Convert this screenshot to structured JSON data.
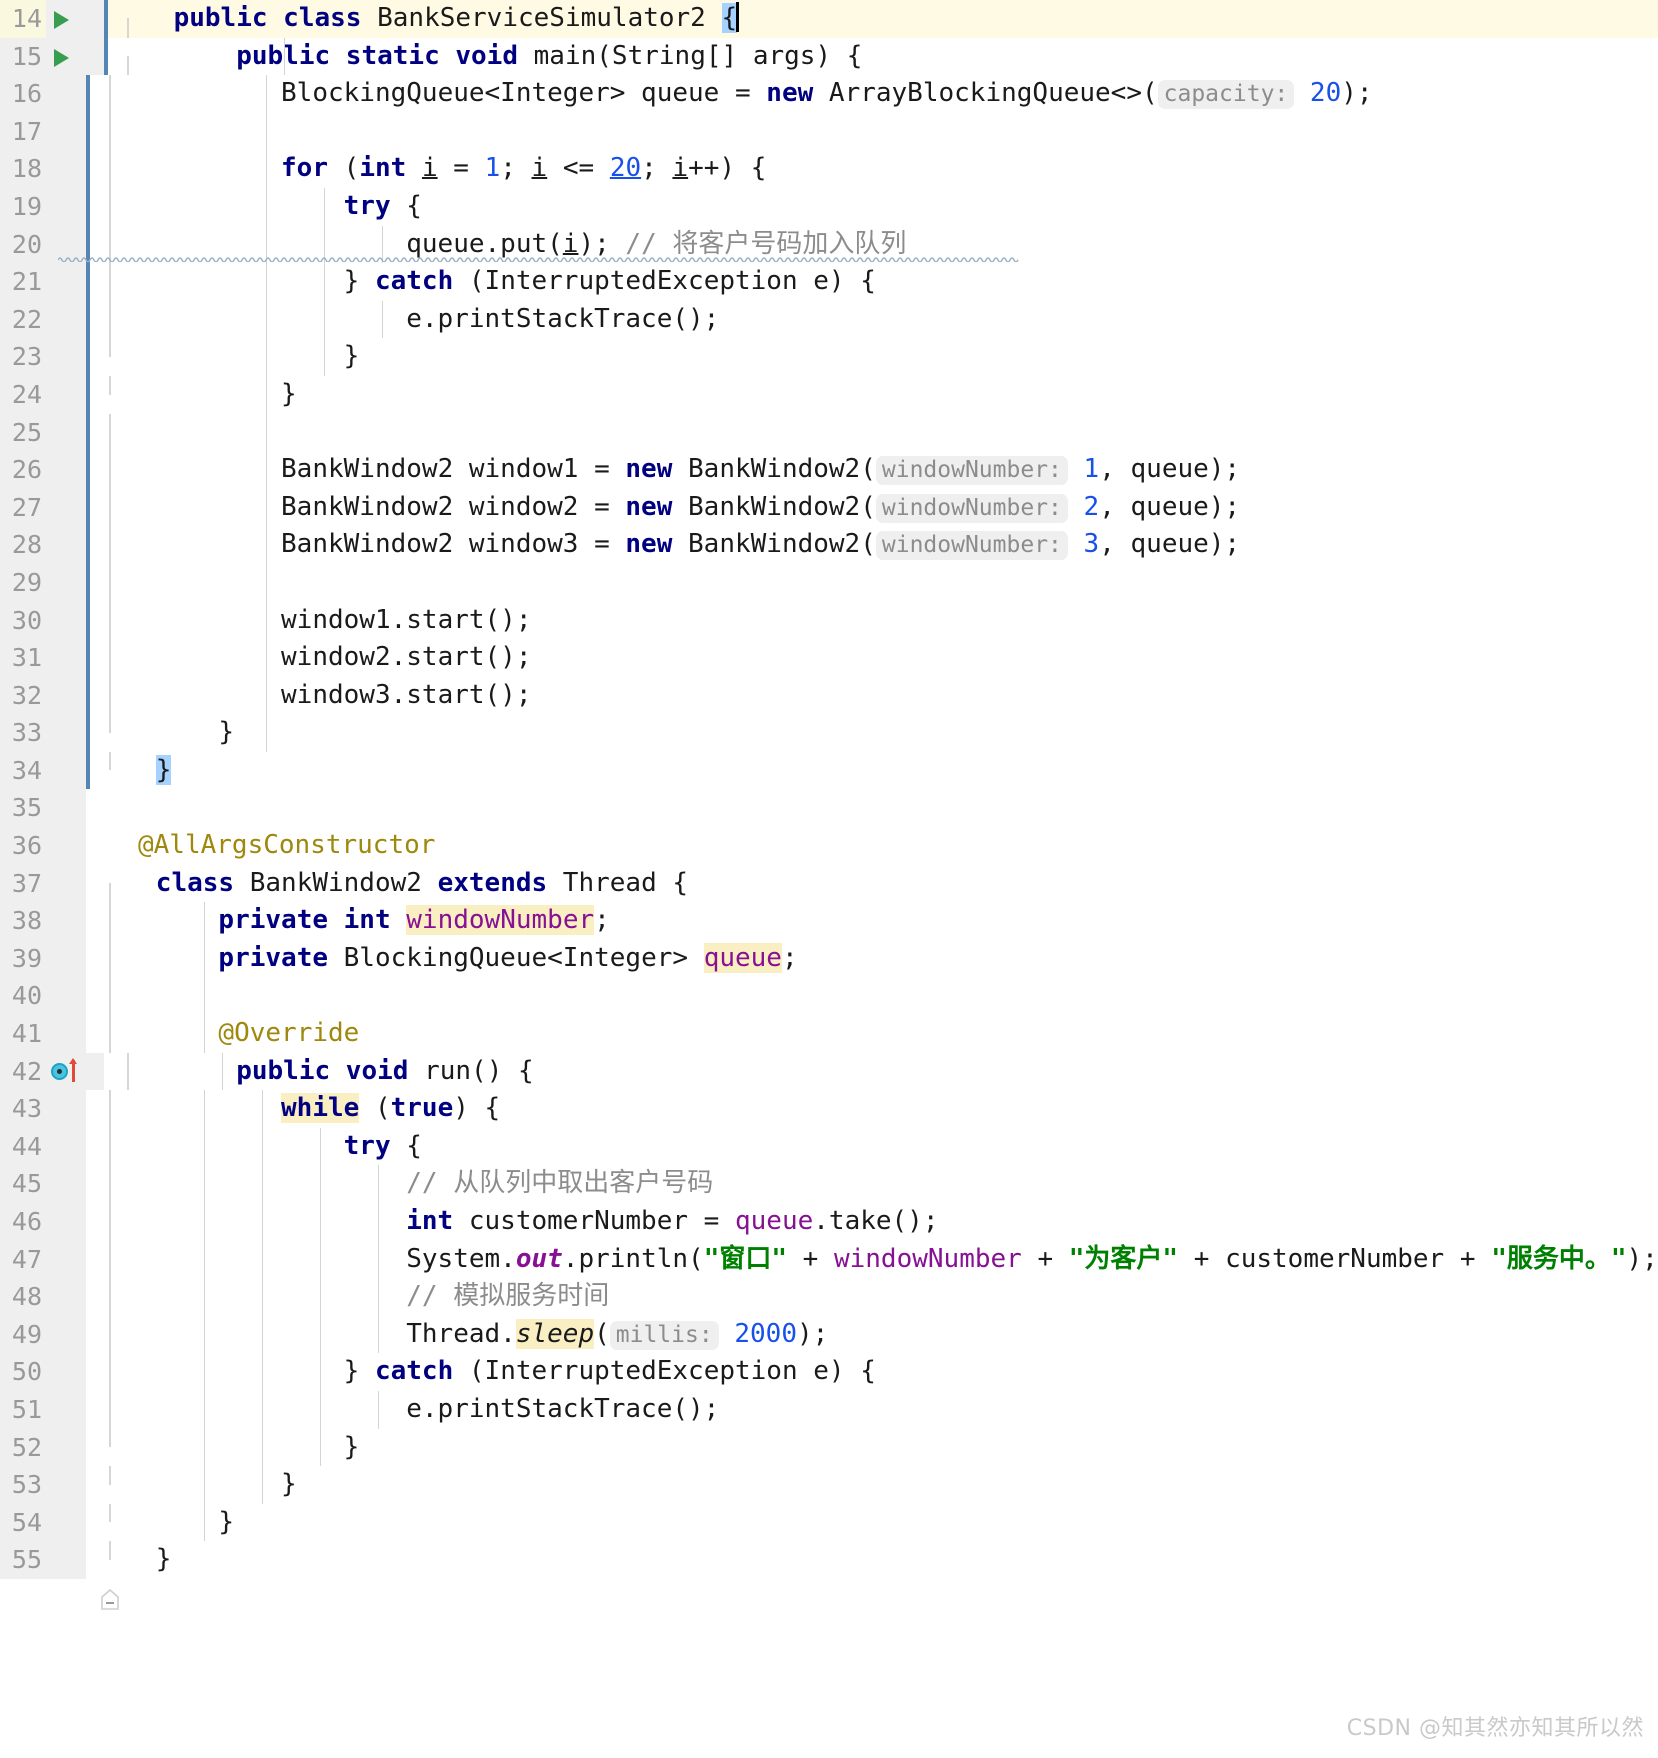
{
  "app": {
    "name": "IntelliJ IDEA Code Editor",
    "language": "Java",
    "file_class": "BankServiceSimulator2"
  },
  "watermark": "CSDN @知其然亦知其所以然",
  "gutter": {
    "run_icon_name": "run-gutter-icon",
    "override_icon_name": "override-method-gutter-icon",
    "fold_icon_name": "code-fold-marker-icon"
  },
  "lines": [
    {
      "n": "14",
      "has_run": true,
      "caret_line": true
    },
    {
      "n": "15",
      "has_run": true
    },
    {
      "n": "16"
    },
    {
      "n": "17"
    },
    {
      "n": "18"
    },
    {
      "n": "19"
    },
    {
      "n": "20"
    },
    {
      "n": "21"
    },
    {
      "n": "22"
    },
    {
      "n": "23"
    },
    {
      "n": "24"
    },
    {
      "n": "25"
    },
    {
      "n": "26"
    },
    {
      "n": "27"
    },
    {
      "n": "28"
    },
    {
      "n": "29"
    },
    {
      "n": "30"
    },
    {
      "n": "31"
    },
    {
      "n": "32"
    },
    {
      "n": "33"
    },
    {
      "n": "34"
    },
    {
      "n": "35"
    },
    {
      "n": "36"
    },
    {
      "n": "37"
    },
    {
      "n": "38"
    },
    {
      "n": "39"
    },
    {
      "n": "40"
    },
    {
      "n": "41"
    },
    {
      "n": "42",
      "has_override": true
    },
    {
      "n": "43"
    },
    {
      "n": "44"
    },
    {
      "n": "45"
    },
    {
      "n": "46"
    },
    {
      "n": "47"
    },
    {
      "n": "48"
    },
    {
      "n": "49"
    },
    {
      "n": "50"
    },
    {
      "n": "51"
    },
    {
      "n": "52"
    },
    {
      "n": "53"
    },
    {
      "n": "54"
    },
    {
      "n": "55"
    }
  ],
  "code": {
    "l14": {
      "kw1": "public",
      "kw2": "class",
      "name": "BankServiceSimulator2",
      "brace": "{"
    },
    "l15": {
      "kw1": "public",
      "kw2": "static",
      "kw3": "void",
      "name": "main",
      "params": "(String[] args) {"
    },
    "l16": {
      "type": "BlockingQueue<Integer> queue = ",
      "kw": "new",
      "ctor": " ArrayBlockingQueue<>(",
      "hint": "capacity:",
      "value": "20",
      "tail": ");"
    },
    "l18": {
      "kw1": "for",
      "open": " (",
      "kw2": "int",
      "v1": "i",
      "eq": " = ",
      "n1": "1",
      "semi": "; ",
      "v2": "i",
      "op": " <= ",
      "n2": "20",
      "semi2": "; ",
      "v3": "i",
      "inc": "++) {"
    },
    "l19": {
      "kw": "try",
      "brace": " {"
    },
    "l20": {
      "call": "queue.put(",
      "arg": "i",
      "tail": "); ",
      "comment": "// 将客户号码加入队列"
    },
    "l21": {
      "close": "} ",
      "kw": "catch",
      "rest": " (InterruptedException e) {"
    },
    "l22": {
      "text": "e.printStackTrace();"
    },
    "l23": {
      "text": "}"
    },
    "l24": {
      "text": "}"
    },
    "l26": {
      "type": "BankWindow2 window1 = ",
      "kw": "new",
      "ctor": " BankWindow2(",
      "hint": "windowNumber:",
      "value": "1",
      "tail": ", queue);"
    },
    "l27": {
      "type": "BankWindow2 window2 = ",
      "kw": "new",
      "ctor": " BankWindow2(",
      "hint": "windowNumber:",
      "value": "2",
      "tail": ", queue);"
    },
    "l28": {
      "type": "BankWindow2 window3 = ",
      "kw": "new",
      "ctor": " BankWindow2(",
      "hint": "windowNumber:",
      "value": "3",
      "tail": ", queue);"
    },
    "l30": {
      "text": "window1.start();"
    },
    "l31": {
      "text": "window2.start();"
    },
    "l32": {
      "text": "window3.start();"
    },
    "l33": {
      "text": "}"
    },
    "l34": {
      "brace": "}"
    },
    "l36": {
      "anno": "@AllArgsConstructor"
    },
    "l37": {
      "kw1": "class",
      "name": " BankWindow2 ",
      "kw2": "extends",
      "rest": " Thread {"
    },
    "l38": {
      "kw1": "private",
      "kw2": "int",
      "field": "windowNumber",
      "semi": ";"
    },
    "l39": {
      "kw1": "private",
      "type": " BlockingQueue<Integer> ",
      "field": "queue",
      "semi": ";"
    },
    "l41": {
      "anno": "@Override"
    },
    "l42": {
      "kw1": "public",
      "kw2": "void",
      "name": "run",
      "rest": "() {"
    },
    "l43": {
      "kw1": "while",
      "open": " (",
      "kw2": "true",
      "rest": ") {"
    },
    "l44": {
      "kw": "try",
      "brace": " {"
    },
    "l45": {
      "comment": "// 从队列中取出客户号码"
    },
    "l46": {
      "kw": "int",
      "rest": " customerNumber = ",
      "obj": "queue",
      "call": ".take();"
    },
    "l47": {
      "sys": "System.",
      "out": "out",
      "print": ".println(",
      "s1": "\"窗口\"",
      "plus1": " + ",
      "f1": "windowNumber",
      "plus2": " + ",
      "s2": "\"为客户\"",
      "plus3": " + ",
      "v2": "customerNumber",
      "plus4": " + ",
      "s3": "\"服务中。\"",
      "tail": ");"
    },
    "l48": {
      "comment": "// 模拟服务时间"
    },
    "l49": {
      "cls": "Thread.",
      "method": "sleep",
      "open": "(",
      "hint": "millis:",
      "value": "2000",
      "tail": ");"
    },
    "l50": {
      "close": "} ",
      "kw": "catch",
      "rest": " (InterruptedException e) {"
    },
    "l51": {
      "text": "e.printStackTrace();"
    },
    "l52": {
      "text": "}"
    },
    "l53": {
      "text": "}"
    },
    "l54": {
      "text": "}"
    },
    "l55": {
      "text": "}"
    }
  }
}
